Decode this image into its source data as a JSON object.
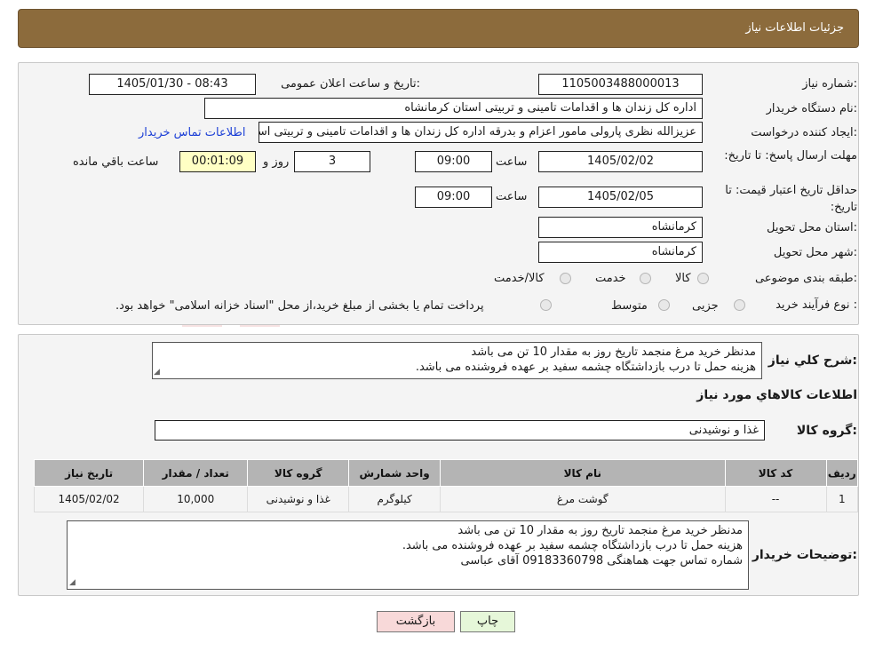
{
  "header": {
    "title": "جزئیات اطلاعات نیاز"
  },
  "form": {
    "need_number_label": "شماره نیاز:",
    "need_number": "1105003488000013",
    "announce_label": "تاریخ و ساعت اعلان عمومی:",
    "announce_value": "1405/01/30 - 08:43",
    "buyer_org_label": "نام دستگاه خریدار:",
    "buyer_org": "اداره کل زندان ها و اقدامات تامینی و تربیتی استان کرمانشاه",
    "creator_label": "ایجاد کننده درخواست:",
    "creator": "عزیزالله نظری پارولی مامور اعزام و بدرقه اداره کل زندان ها و اقدامات تامینی و تربیتی استان کرمانشاه",
    "contact_link": "اطلاعات تماس خریدار",
    "deadline_label": "مهلت ارسال پاسخ: تا تاریخ:",
    "deadline_date": "1405/02/02",
    "time_label": "ساعت",
    "deadline_time": "09:00",
    "days_value": "3",
    "days_label": "روز و",
    "remaining_time": "00:01:09",
    "remaining_label": "ساعت باقي مانده",
    "validity_label": "حداقل تاریخ اعتبار قیمت: تا تاریخ:",
    "validity_date": "1405/02/05",
    "validity_time": "09:00",
    "province_label": "استان محل تحویل:",
    "province": "کرمانشاه",
    "city_label": "شهر محل تحویل:",
    "city": "کرمانشاه",
    "category_label": "طبقه بندی موضوعی:",
    "category_options": [
      "کالا",
      "خدمت",
      "کالا/خدمت"
    ],
    "process_label": "نوع فرآیند خرید :",
    "process_options": [
      "جزیی",
      "متوسط"
    ],
    "process_note": "پرداخت تمام یا بخشی از مبلغ خرید،از محل \"اسناد خزانه اسلامی\" خواهد بود."
  },
  "description": {
    "label": "شرح کلي نياز:",
    "text": "مدنظر خرید مرغ منجمد تاریخ روز به مقدار 10 تن می باشد\nهزینه حمل تا درب بازداشتگاه چشمه سفید بر عهده فروشنده می باشد."
  },
  "goods": {
    "section_title": "اطلاعات کالاهاي مورد نياز",
    "group_label": "گروه کالا:",
    "group_value": "غذا و نوشیدنی",
    "columns": [
      "رديف",
      "کد کالا",
      "نام کالا",
      "واحد شمارش",
      "گروه کالا",
      "تعداد / مقدار",
      "تاريخ نياز"
    ],
    "rows": [
      [
        "1",
        "--",
        "گوشت مرغ",
        "کیلوگرم",
        "غذا و نوشیدنی",
        "10,000",
        "1405/02/02"
      ]
    ]
  },
  "buyer_notes": {
    "label": "توضیحات خریدار:",
    "text": "مدنظر خرید مرغ منجمد تاریخ روز به مقدار 10 تن می باشد\nهزینه حمل تا درب بازداشتگاه چشمه سفید بر عهده فروشنده می باشد.\nشماره تماس جهت هماهنگی 09183360798 آقای عباسی"
  },
  "buttons": {
    "print": "چاپ",
    "back": "بازگشت"
  },
  "colors": {
    "header_bg": "#8c6b3c",
    "link": "#1c3fd6",
    "remaining_bg": "#ffffc4",
    "back_bg": "#f8d9d9",
    "print_bg": "#e6f7d9"
  }
}
